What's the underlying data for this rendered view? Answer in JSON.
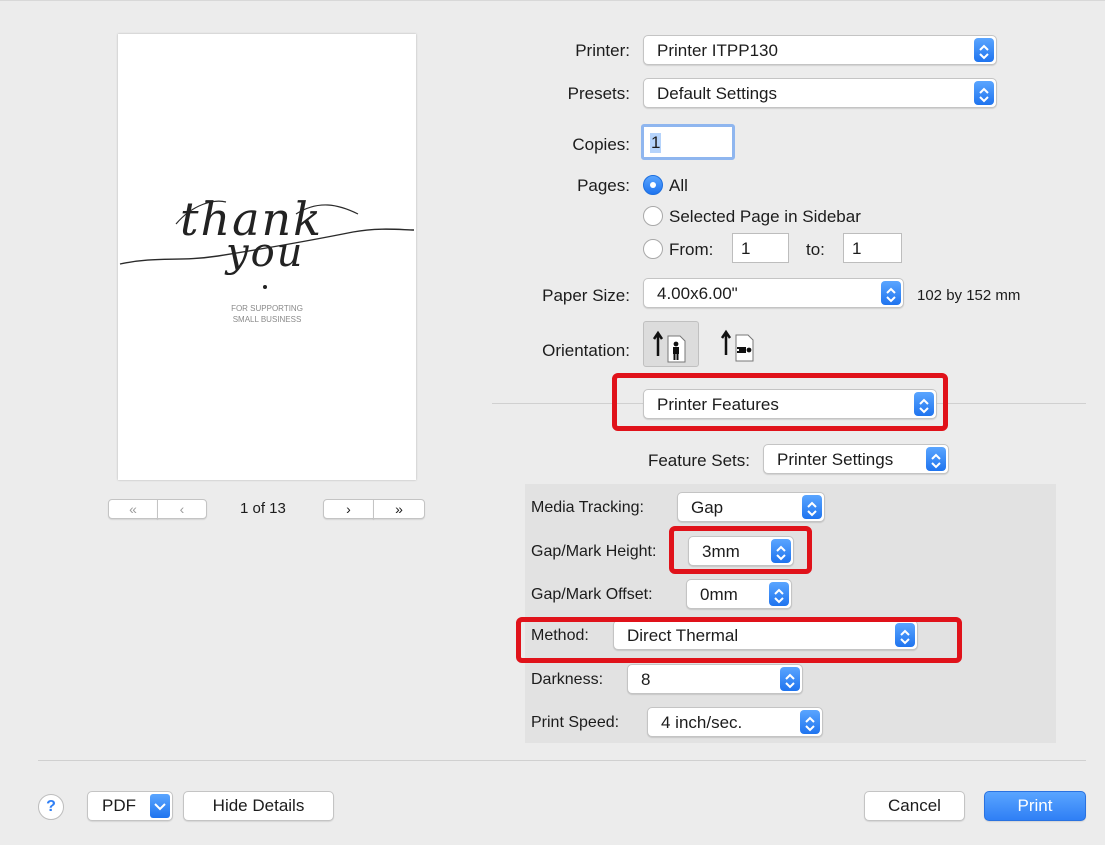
{
  "colors": {
    "accent": "#2f7ff5",
    "highlight": "#e0121a"
  },
  "preview": {
    "script_line1": "thank",
    "script_line2": "you",
    "caption_line1": "FOR SUPPORTING",
    "caption_line2": "SMALL BUSINESS",
    "page_indicator": "1 of 13",
    "first_icon": "double-chevron-left-icon",
    "prev_icon": "chevron-left-icon",
    "next_icon": "chevron-right-icon",
    "last_icon": "double-chevron-right-icon"
  },
  "printer": {
    "label": "Printer:",
    "value": "Printer ITPP130"
  },
  "presets": {
    "label": "Presets:",
    "value": "Default Settings"
  },
  "copies": {
    "label": "Copies:",
    "value": "1"
  },
  "pages": {
    "label": "Pages:",
    "all_label": "All",
    "selected_label": "Selected Page in Sidebar",
    "from_label": "From:",
    "from_value": "1",
    "to_label": "to:",
    "to_value": "1"
  },
  "paper_size": {
    "label": "Paper Size:",
    "value": "4.00x6.00\"",
    "dimensions": "102 by 152 mm"
  },
  "orientation": {
    "label": "Orientation:"
  },
  "section": {
    "value": "Printer Features"
  },
  "feature_sets": {
    "label": "Feature Sets:",
    "value": "Printer Settings"
  },
  "features": {
    "media_tracking": {
      "label": "Media Tracking:",
      "value": "Gap"
    },
    "gap_height": {
      "label": "Gap/Mark Height:",
      "value": "3mm"
    },
    "gap_offset": {
      "label": "Gap/Mark Offset:",
      "value": "0mm"
    },
    "method": {
      "label": "Method:",
      "value": "Direct Thermal"
    },
    "darkness": {
      "label": "Darkness:",
      "value": "8"
    },
    "print_speed": {
      "label": "Print Speed:",
      "value": "4 inch/sec."
    }
  },
  "footer": {
    "help_label": "?",
    "pdf_label": "PDF",
    "hide_details_label": "Hide Details",
    "cancel_label": "Cancel",
    "print_label": "Print"
  }
}
